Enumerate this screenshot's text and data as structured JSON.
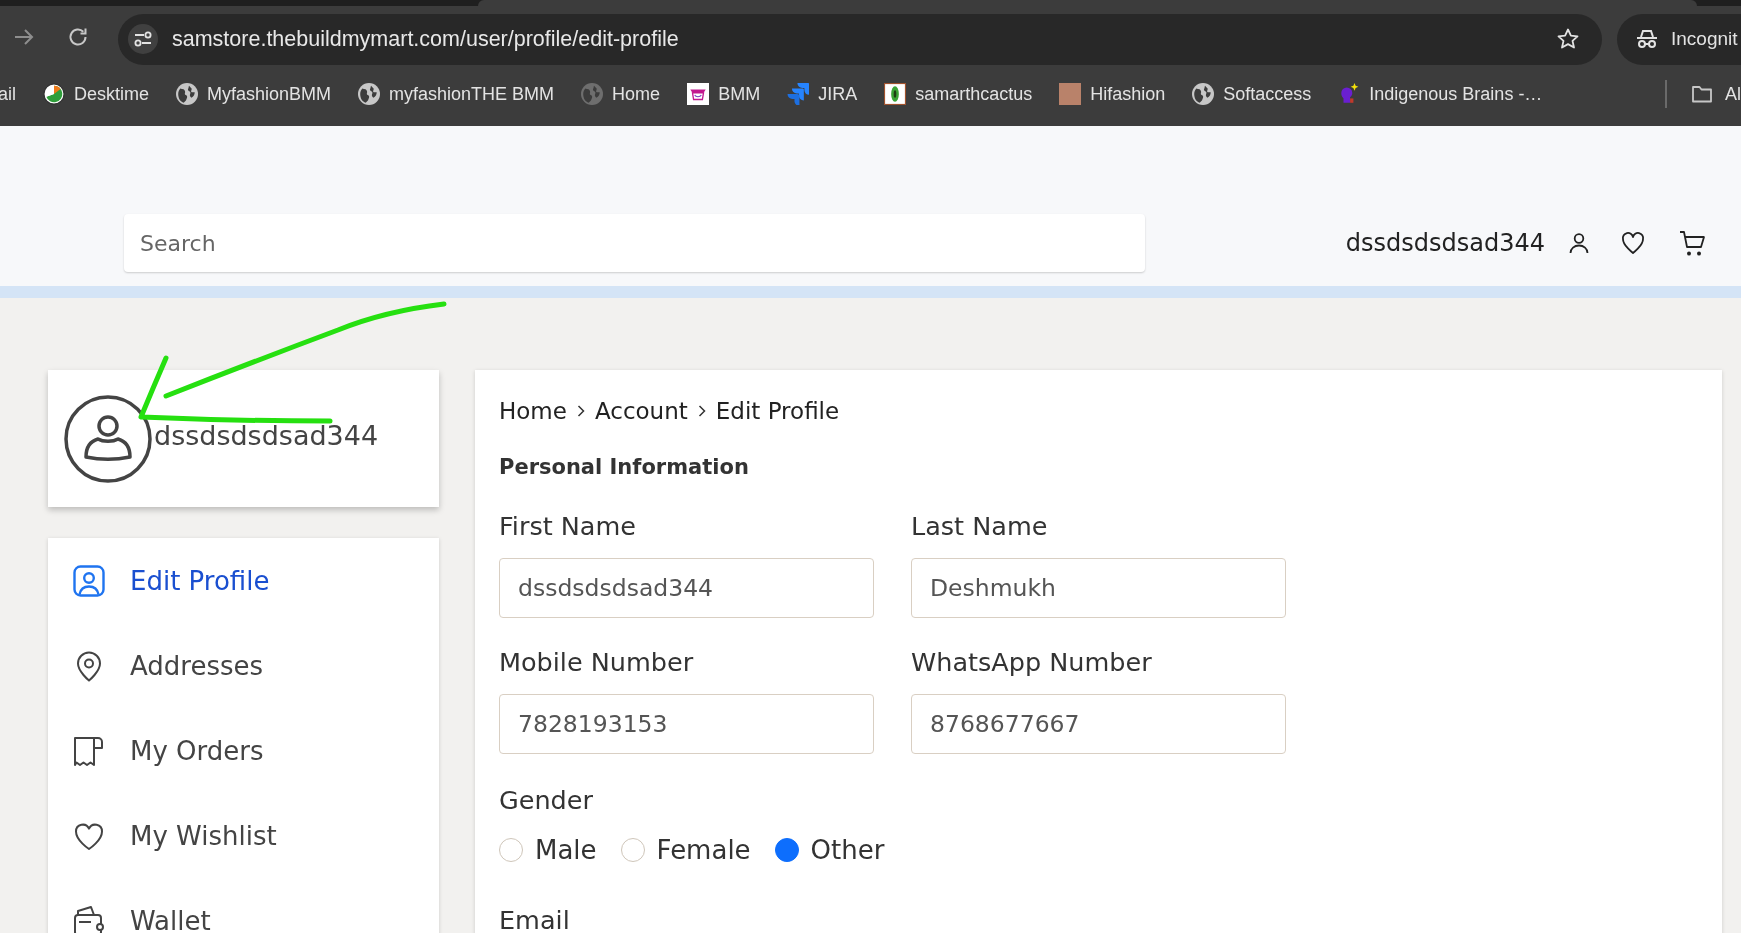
{
  "browser": {
    "url": "samstore.thebuildmymart.com/user/profile/edit-profile",
    "profile_label": "Incognit",
    "bookmarks": [
      {
        "label": "ail",
        "kind": "none"
      },
      {
        "label": "Desktime",
        "kind": "clock"
      },
      {
        "label": "MyfashionBMM",
        "kind": "globe"
      },
      {
        "label": "myfashionTHE BMM",
        "kind": "globe"
      },
      {
        "label": "Home",
        "kind": "globe-dim"
      },
      {
        "label": "BMM",
        "kind": "basket"
      },
      {
        "label": "JIRA",
        "kind": "chevrons"
      },
      {
        "label": "samarthcactus",
        "kind": "leaf"
      },
      {
        "label": "Hifashion",
        "kind": "photo"
      },
      {
        "label": "Softaccess",
        "kind": "globe"
      },
      {
        "label": "Indigenous Brains -…",
        "kind": "figure"
      }
    ],
    "all_bookmarks": "Al"
  },
  "header": {
    "search_placeholder": "Search",
    "username": "dssdsdsdsad344"
  },
  "profile_card": {
    "name": "dssdsdsdsad344"
  },
  "menu": [
    {
      "label": "Edit Profile",
      "kind": "profile",
      "selected": true
    },
    {
      "label": "Addresses",
      "kind": "pin",
      "selected": false
    },
    {
      "label": "My Orders",
      "kind": "receipt",
      "selected": false
    },
    {
      "label": "My Wishlist",
      "kind": "heart",
      "selected": false
    },
    {
      "label": "Wallet",
      "kind": "wallet",
      "selected": false
    }
  ],
  "breadcrumb": [
    "Home",
    "Account",
    "Edit Profile"
  ],
  "form": {
    "title": "Personal Information",
    "fields": [
      {
        "label": "First Name",
        "value": "dssdsdsdsad344"
      },
      {
        "label": "Last Name",
        "value": "Deshmukh"
      },
      {
        "label": "Mobile Number",
        "value": "7828193153"
      },
      {
        "label": "WhatsApp Number",
        "value": "8768677667"
      }
    ],
    "gender": {
      "label": "Gender",
      "options": [
        {
          "label": "Male",
          "selected": false
        },
        {
          "label": "Female",
          "selected": false
        },
        {
          "label": "Other",
          "selected": true
        }
      ]
    },
    "email": {
      "label": "Email"
    }
  }
}
